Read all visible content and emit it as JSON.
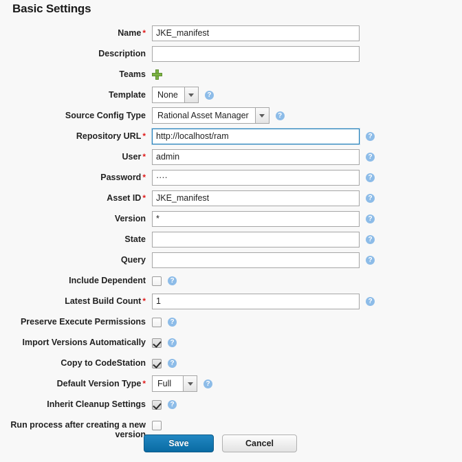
{
  "page": {
    "title": "Basic Settings"
  },
  "fields": [
    {
      "label": "Name",
      "required": true,
      "type": "text",
      "value": "JKE_manifest",
      "help": false
    },
    {
      "label": "Description",
      "required": false,
      "type": "text",
      "value": "",
      "help": false
    },
    {
      "label": "Teams",
      "required": false,
      "type": "plus",
      "value": "",
      "help": false,
      "icon": "plus-icon"
    },
    {
      "label": "Template",
      "required": false,
      "type": "select",
      "value": "None",
      "help": true
    },
    {
      "label": "Source Config Type",
      "required": false,
      "type": "select",
      "value": "Rational Asset Manager",
      "help": true
    },
    {
      "label": "Repository URL",
      "required": true,
      "type": "text",
      "value": "http://localhost/ram",
      "help": true,
      "focused": true
    },
    {
      "label": "User",
      "required": true,
      "type": "text",
      "value": "admin",
      "help": true
    },
    {
      "label": "Password",
      "required": true,
      "type": "password",
      "value": "····",
      "help": true
    },
    {
      "label": "Asset ID",
      "required": true,
      "type": "text",
      "value": "JKE_manifest",
      "help": true
    },
    {
      "label": "Version",
      "required": false,
      "type": "text",
      "value": "*",
      "help": true
    },
    {
      "label": "State",
      "required": false,
      "type": "text",
      "value": "",
      "help": true
    },
    {
      "label": "Query",
      "required": false,
      "type": "text",
      "value": "",
      "help": true
    },
    {
      "label": "Include Dependent",
      "required": false,
      "type": "checkbox",
      "checked": false,
      "help": true
    },
    {
      "label": "Latest Build Count",
      "required": true,
      "type": "text",
      "value": "1",
      "help": true
    },
    {
      "label": "Preserve Execute Permissions",
      "required": false,
      "type": "checkbox",
      "checked": false,
      "help": true
    },
    {
      "label": "Import Versions Automatically",
      "required": false,
      "type": "checkbox",
      "checked": true,
      "help": true
    },
    {
      "label": "Copy to CodeStation",
      "required": false,
      "type": "checkbox",
      "checked": true,
      "help": true
    },
    {
      "label": "Default Version Type",
      "required": true,
      "type": "select",
      "value": "Full",
      "help": true
    },
    {
      "label": "Inherit Cleanup Settings",
      "required": false,
      "type": "checkbox",
      "checked": true,
      "help": true
    },
    {
      "label": "Run process after creating a new\nversion",
      "required": false,
      "type": "checkbox",
      "checked": false,
      "help": false,
      "tall": true
    }
  ],
  "buttons": {
    "save_label": "Save",
    "cancel_label": "Cancel"
  },
  "glyphs": {
    "help": "?"
  },
  "colors": {
    "background": "#f8f8f8",
    "required_marker": "#e01b1b",
    "focus_border": "#1a7bb9",
    "help_icon": "#8dbce8",
    "plus_icon": "#7cb342",
    "primary_button": "#0a6ba3"
  }
}
